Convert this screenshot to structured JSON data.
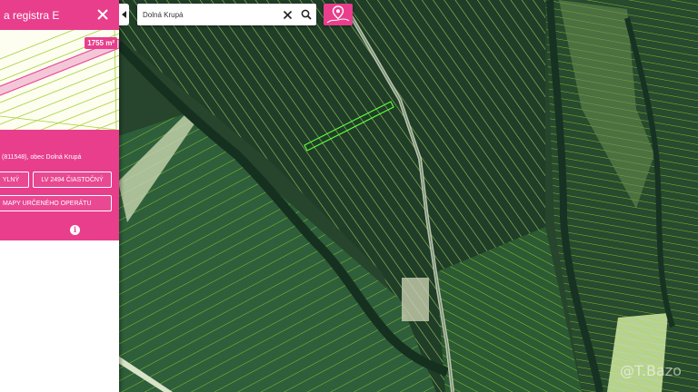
{
  "panel": {
    "title": "a registra E",
    "area_badge": "1755 m²",
    "locality": "(811548), obec Dolná Krupá",
    "buttons": {
      "full": "YLNÝ",
      "lv": "LV 2494 ČIASTOČNÝ",
      "map_operat": "MAPY URČENÉHO OPERÁTU"
    },
    "info_symbol": "i"
  },
  "search": {
    "value": "Dolná Krupá",
    "placeholder": ""
  },
  "icons": {
    "close": "close-icon",
    "collapse": "chevron-left-icon",
    "clear": "clear-icon",
    "search": "search-icon",
    "marker": "map-marker-icon",
    "info": "info-icon"
  },
  "colors": {
    "accent": "#e83e8c",
    "parcel_lines": "#a6e22e"
  },
  "watermark": "@T.Bazo"
}
